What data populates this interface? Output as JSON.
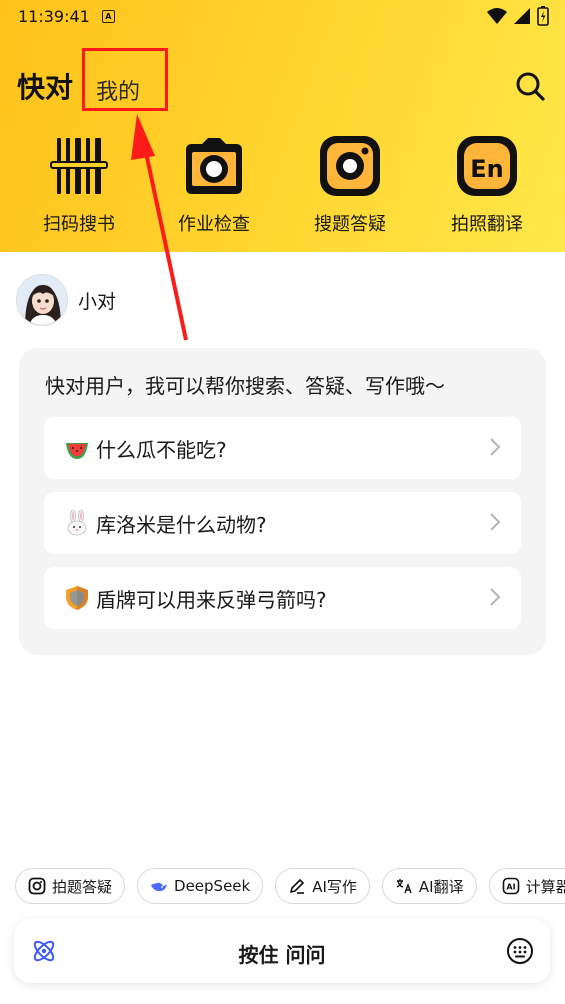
{
  "status_bar": {
    "time": "11:39:41",
    "indicator": "A"
  },
  "header": {
    "app_title": "快对",
    "mine_tab": "我的",
    "search_icon": "search-icon"
  },
  "tools": [
    {
      "label": "扫码搜书",
      "icon": "barcode-icon"
    },
    {
      "label": "作业检查",
      "icon": "camera-icon"
    },
    {
      "label": "搜题答疑",
      "icon": "lens-icon"
    },
    {
      "label": "拍照翻译",
      "icon": "en-translate-icon"
    }
  ],
  "assistant": {
    "name": "小对"
  },
  "card": {
    "greeting": "快对用户，我可以帮你搜索、答疑、写作哦～",
    "suggestions": [
      {
        "text": "什么瓜不能吃?",
        "icon": "watermelon-icon"
      },
      {
        "text": "库洛米是什么动物?",
        "icon": "rabbit-icon"
      },
      {
        "text": "盾牌可以用来反弹弓箭吗?",
        "icon": "shield-icon"
      }
    ]
  },
  "chips": [
    {
      "label": "拍题答疑",
      "icon": "camera-icon"
    },
    {
      "label": "DeepSeek",
      "icon": "whale-icon"
    },
    {
      "label": "AI写作",
      "icon": "pen-icon"
    },
    {
      "label": "AI翻译",
      "icon": "translate-icon"
    },
    {
      "label": "计算器",
      "icon": "ai-icon"
    }
  ],
  "input_bar": {
    "hold_label": "按住 问问"
  },
  "colors": {
    "brand_yellow": "#ffd02a",
    "highlight_red": "#ff1a1a"
  }
}
